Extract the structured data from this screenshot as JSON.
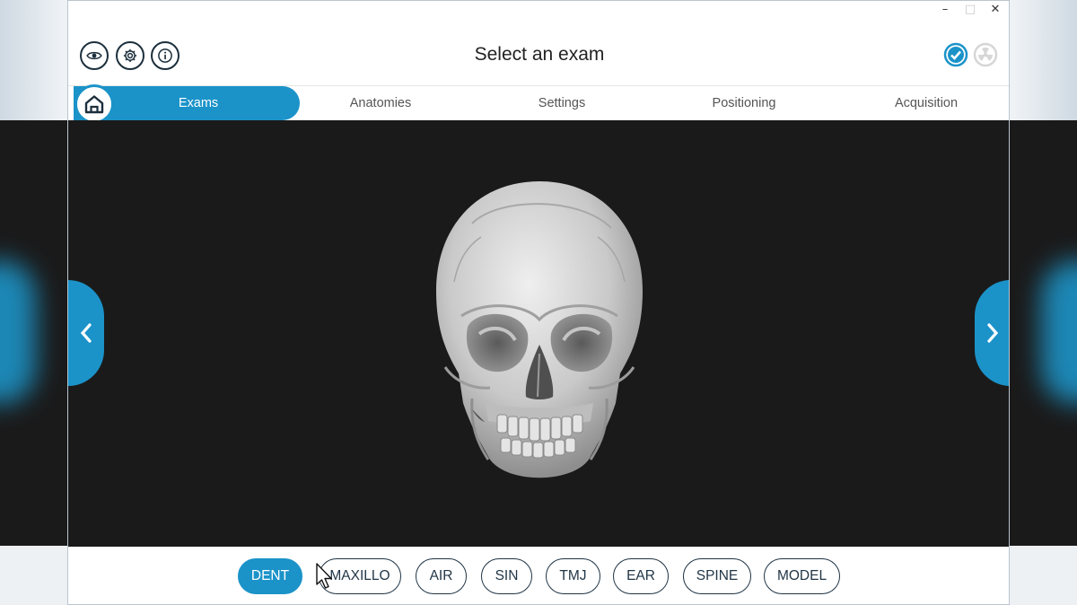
{
  "window": {
    "controls": {
      "minimize": "–",
      "maximize": "□",
      "close": "✕"
    }
  },
  "header": {
    "title": "Select an exam",
    "buttons": [
      {
        "name": "visibility",
        "icon": "eye-icon"
      },
      {
        "name": "settings",
        "icon": "gear-icon"
      },
      {
        "name": "info",
        "icon": "info-icon"
      }
    ],
    "status_icons": [
      "check-circle-icon",
      "radiation-icon"
    ]
  },
  "tabs": [
    {
      "label": "Exams",
      "active": true
    },
    {
      "label": "Anatomies",
      "active": false
    },
    {
      "label": "Settings",
      "active": false
    },
    {
      "label": "Positioning",
      "active": false
    },
    {
      "label": "Acquisition",
      "active": false
    }
  ],
  "home": {
    "icon": "home-icon"
  },
  "viewport": {
    "image": "skull-3d-model",
    "nav": {
      "prev_icon": "chevron-left-icon",
      "next_icon": "chevron-right-icon"
    }
  },
  "exams": [
    {
      "label": "DENT",
      "active": true
    },
    {
      "label": "MAXILLO",
      "active": false
    },
    {
      "label": "AIR",
      "active": false
    },
    {
      "label": "SIN",
      "active": false
    },
    {
      "label": "TMJ",
      "active": false
    },
    {
      "label": "EAR",
      "active": false
    },
    {
      "label": "SPINE",
      "active": false
    },
    {
      "label": "MODEL",
      "active": false
    }
  ],
  "colors": {
    "accent": "#1b93c9",
    "dark": "#1f3445",
    "viewport_bg": "#1a1a1a",
    "check": "#1b93c9",
    "disabled": "#d6d6d6"
  }
}
